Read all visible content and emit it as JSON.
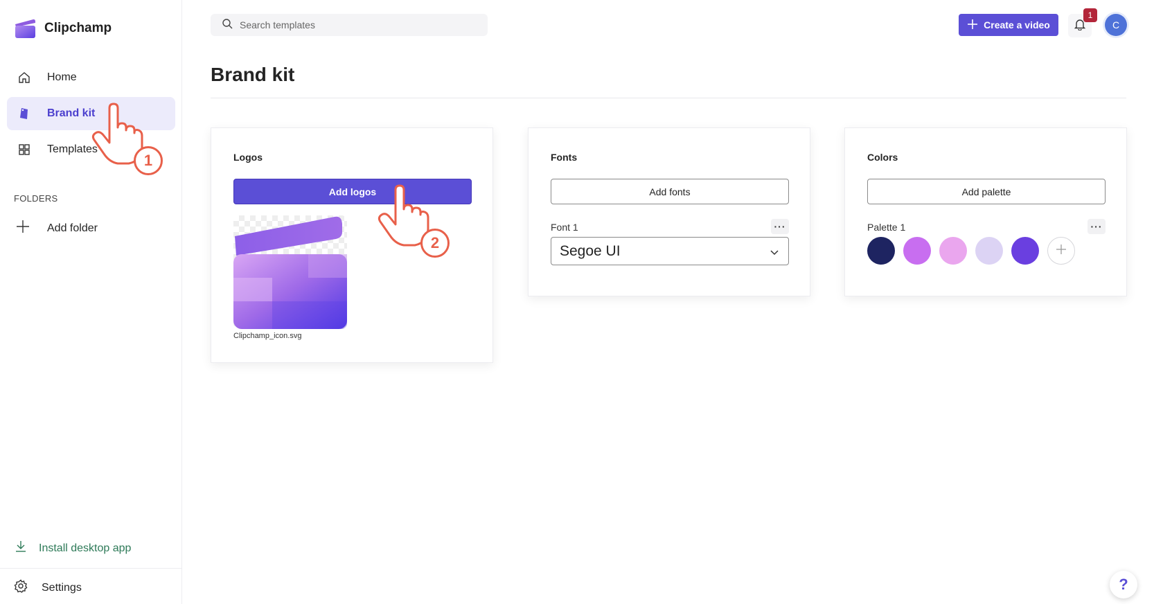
{
  "app": {
    "name": "Clipchamp"
  },
  "sidebar": {
    "items": [
      {
        "label": "Home",
        "icon": "home-icon"
      },
      {
        "label": "Brand kit",
        "icon": "brand-kit-icon",
        "active": true
      },
      {
        "label": "Templates",
        "icon": "templates-icon"
      }
    ],
    "folders_label": "FOLDERS",
    "add_folder_label": "Add folder",
    "install_label": "Install desktop app",
    "settings_label": "Settings"
  },
  "topbar": {
    "search_placeholder": "Search templates",
    "create_label": "Create a video",
    "notification_count": "1",
    "avatar_initial": "C"
  },
  "main": {
    "title": "Brand kit",
    "logos": {
      "title": "Logos",
      "button_label": "Add logos",
      "file_name": "Clipchamp_icon.svg"
    },
    "fonts": {
      "title": "Fonts",
      "button_label": "Add fonts",
      "font_label": "Font 1",
      "font_value": "Segoe UI",
      "more_label": "···"
    },
    "colors": {
      "title": "Colors",
      "button_label": "Add palette",
      "palette_label": "Palette 1",
      "more_label": "···",
      "swatches": [
        "#1e2461",
        "#c86ef0",
        "#eaa6ee",
        "#dcd3f4",
        "#6a3fe0"
      ]
    }
  },
  "annotations": {
    "step1": "1",
    "step2": "2"
  },
  "help_label": "?",
  "colors": {
    "accent": "#5b4fd6",
    "pointer": "#e8604a"
  }
}
